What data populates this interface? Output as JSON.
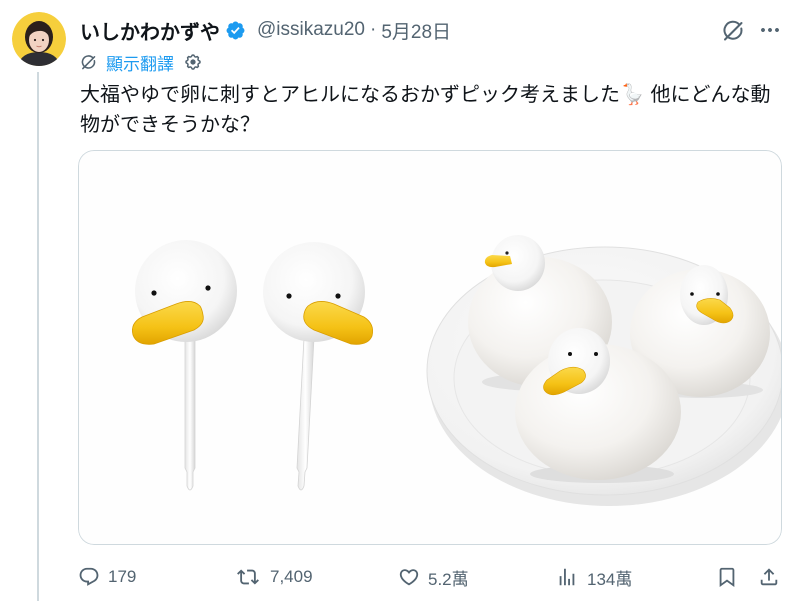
{
  "tweet": {
    "author": {
      "display_name": "いしかわかずや",
      "handle": "@issikazu20",
      "separator": "·",
      "date": "5月28日"
    },
    "translate_label": "顯示翻譯",
    "text_lines": [
      "大福やゆで卵に刺すとアヒルになるおかずピック考えました🪿 他にどんな動",
      "物ができそうかな？"
    ],
    "actions": {
      "replies": "179",
      "reposts": "7,409",
      "likes": "5.2萬",
      "views": "134萬"
    }
  },
  "icons": {
    "verified": "verified-badge-icon",
    "grok": "grok-icon",
    "more": "more-options-icon",
    "translate": "grok-translate-icon",
    "translate_settings": "gear-icon",
    "reply": "reply-icon",
    "repost": "repost-icon",
    "like": "heart-icon",
    "views": "views-icon",
    "bookmark": "bookmark-icon",
    "share": "share-icon"
  },
  "colors": {
    "text_primary": "#0f1419",
    "text_secondary": "#536471",
    "accent": "#1d9bf0",
    "border": "#cfd9de",
    "beak_yellow": "#f5c216",
    "avatar_background": "#f6cf3c"
  }
}
